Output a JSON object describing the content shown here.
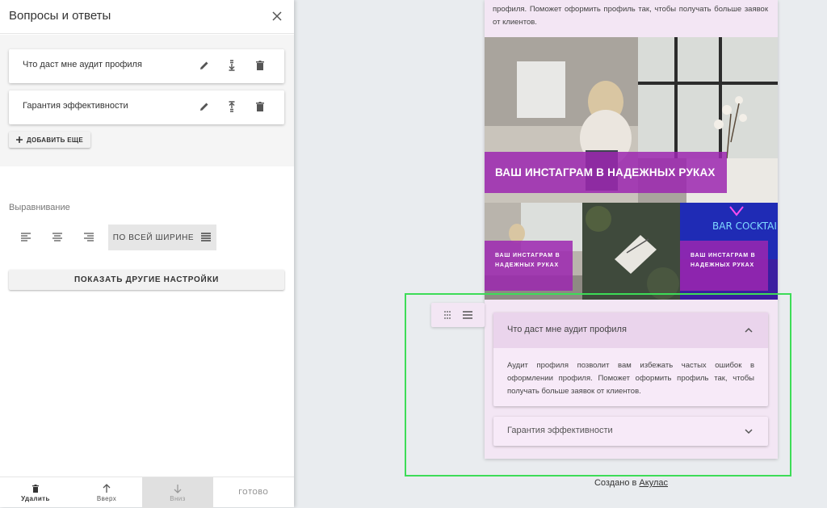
{
  "panel": {
    "title": "Вопросы и ответы",
    "items": [
      {
        "label": "Что даст мне аудит профиля"
      },
      {
        "label": "Гарантия эффективности"
      }
    ],
    "add_label": "ДОБАВИТЬ ЕЩЕ",
    "align_label": "Выравнивание",
    "align_full_label": "ПО ВСЕЙ ШИРИНЕ",
    "more_settings_label": "ПОКАЗАТЬ ДРУГИЕ НАСТРОЙКИ",
    "footer": {
      "delete_label": "Удалить",
      "up_label": "Вверх",
      "down_label": "Вниз",
      "done_label": "ГОТОВО"
    }
  },
  "preview": {
    "top_text": "профиля. Поможет оформить профиль так, чтобы получать больше заявок от клиентов.",
    "hero_banner": "ВАШ ИНСТАГРАМ В НАДЕЖНЫХ РУКАХ",
    "tiles": [
      {
        "banner": "ВАШ ИНСТАГРАМ В НАДЕЖНЫХ РУКАХ"
      },
      {
        "banner": ""
      },
      {
        "banner": "ВАШ ИНСТАГРАМ В НАДЕЖНЫХ РУКАХ",
        "neon": "BAR COCKTAILS"
      }
    ],
    "faq": [
      {
        "question": "Что даст мне аудит профиля",
        "answer": "Аудит профиля позволит вам избежать частых ошибок в оформлении профиля. Поможет оформить профиль так, чтобы получать больше заявок от клиентов.",
        "expanded": true
      },
      {
        "question": "Гарантия эффективности",
        "expanded": false
      }
    ],
    "credit_prefix": "Создано в",
    "credit_link": "Акулас"
  },
  "colors": {
    "accent_purple": "#9c27b0",
    "selection_green": "#3ddc57",
    "preview_bg": "#f3e6f4"
  }
}
